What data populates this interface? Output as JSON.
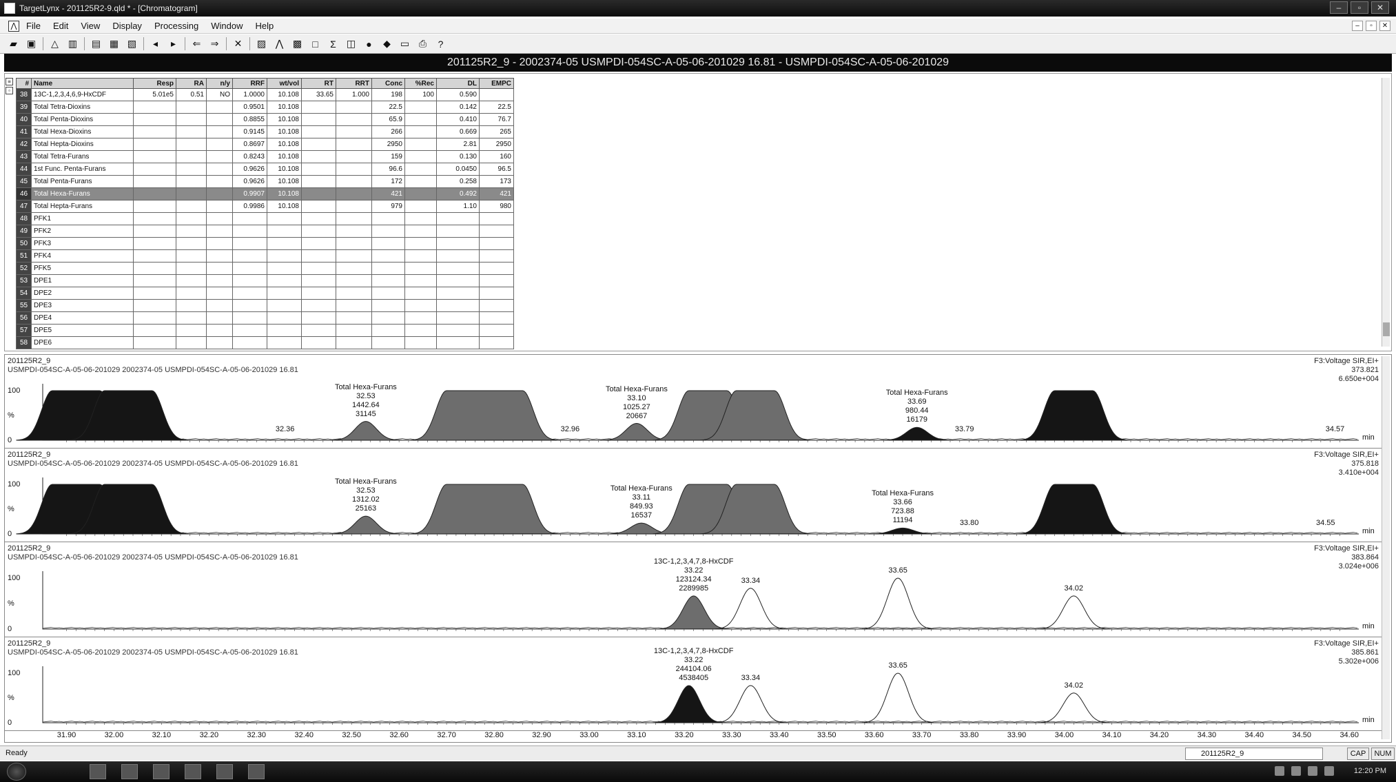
{
  "window": {
    "title": "TargetLynx - 201125R2-9.qld * - [Chromatogram]"
  },
  "menu": [
    "File",
    "Edit",
    "View",
    "Display",
    "Processing",
    "Window",
    "Help"
  ],
  "toolbar_icons": [
    "open-icon",
    "save-icon",
    "sep",
    "integrate-icon",
    "quantify-icon",
    "sep",
    "report-icon",
    "preview-icon",
    "print-preview-icon",
    "sep",
    "prev-sample-icon",
    "next-sample-icon",
    "sep",
    "prev-compound-icon",
    "next-compound-icon",
    "sep",
    "zoom-icon",
    "sep",
    "tools-icon",
    "peak-icon",
    "chromatogram-icon",
    "spectrum-icon",
    "table-icon",
    "summary-icon",
    "settings-icon",
    "layout-icon",
    "split-icon",
    "print-icon",
    "help-icon"
  ],
  "sample_title": "201125R2_9 - 2002374-05 USMPDI-054SC-A-05-06-201029 16.81 - USMPDI-054SC-A-05-06-201029",
  "table": {
    "columns": [
      "#",
      "Name",
      "Resp",
      "RA",
      "n/y",
      "RRF",
      "wt/vol",
      "RT",
      "RRT",
      "Conc",
      "%Rec",
      "DL",
      "EMPC"
    ],
    "rows": [
      [
        "38",
        "13C-1,2,3,4,6,9-HxCDF",
        "5.01e5",
        "0.51",
        "NO",
        "1.0000",
        "10.108",
        "33.65",
        "1.000",
        "198",
        "100",
        "0.590",
        ""
      ],
      [
        "39",
        "Total Tetra-Dioxins",
        "",
        "",
        "",
        "0.9501",
        "10.108",
        "",
        "",
        "22.5",
        "",
        "0.142",
        "22.5"
      ],
      [
        "40",
        "Total Penta-Dioxins",
        "",
        "",
        "",
        "0.8855",
        "10.108",
        "",
        "",
        "65.9",
        "",
        "0.410",
        "76.7"
      ],
      [
        "41",
        "Total Hexa-Dioxins",
        "",
        "",
        "",
        "0.9145",
        "10.108",
        "",
        "",
        "266",
        "",
        "0.669",
        "265"
      ],
      [
        "42",
        "Total Hepta-Dioxins",
        "",
        "",
        "",
        "0.8697",
        "10.108",
        "",
        "",
        "2950",
        "",
        "2.81",
        "2950"
      ],
      [
        "43",
        "Total Tetra-Furans",
        "",
        "",
        "",
        "0.8243",
        "10.108",
        "",
        "",
        "159",
        "",
        "0.130",
        "160"
      ],
      [
        "44",
        "1st Func. Penta-Furans",
        "",
        "",
        "",
        "0.9626",
        "10.108",
        "",
        "",
        "96.6",
        "",
        "0.0450",
        "96.5"
      ],
      [
        "45",
        "Total Penta-Furans",
        "",
        "",
        "",
        "0.9626",
        "10.108",
        "",
        "",
        "172",
        "",
        "0.258",
        "173"
      ],
      [
        "46",
        "Total Hexa-Furans",
        "",
        "",
        "",
        "0.9907",
        "10.108",
        "",
        "",
        "421",
        "",
        "0.492",
        "421"
      ],
      [
        "47",
        "Total Hepta-Furans",
        "",
        "",
        "",
        "0.9986",
        "10.108",
        "",
        "",
        "979",
        "",
        "1.10",
        "980"
      ],
      [
        "48",
        "PFK1",
        "",
        "",
        "",
        "",
        "",
        "",
        "",
        "",
        "",
        "",
        ""
      ],
      [
        "49",
        "PFK2",
        "",
        "",
        "",
        "",
        "",
        "",
        "",
        "",
        "",
        "",
        ""
      ],
      [
        "50",
        "PFK3",
        "",
        "",
        "",
        "",
        "",
        "",
        "",
        "",
        "",
        "",
        ""
      ],
      [
        "51",
        "PFK4",
        "",
        "",
        "",
        "",
        "",
        "",
        "",
        "",
        "",
        "",
        ""
      ],
      [
        "52",
        "PFK5",
        "",
        "",
        "",
        "",
        "",
        "",
        "",
        "",
        "",
        "",
        ""
      ],
      [
        "53",
        "DPE1",
        "",
        "",
        "",
        "",
        "",
        "",
        "",
        "",
        "",
        "",
        ""
      ],
      [
        "54",
        "DPE2",
        "",
        "",
        "",
        "",
        "",
        "",
        "",
        "",
        "",
        "",
        ""
      ],
      [
        "55",
        "DPE3",
        "",
        "",
        "",
        "",
        "",
        "",
        "",
        "",
        "",
        "",
        ""
      ],
      [
        "56",
        "DPE4",
        "",
        "",
        "",
        "",
        "",
        "",
        "",
        "",
        "",
        "",
        ""
      ],
      [
        "57",
        "DPE5",
        "",
        "",
        "",
        "",
        "",
        "",
        "",
        "",
        "",
        "",
        ""
      ],
      [
        "58",
        "DPE6",
        "",
        "",
        "",
        "",
        "",
        "",
        "",
        "",
        "",
        "",
        ""
      ]
    ],
    "selected_row": "46"
  },
  "chromatograms": [
    {
      "sample": "201125R2_9",
      "desc": "USMPDI-054SC-A-05-06-201029 2002374-05 USMPDI-054SC-A-05-06-201029 16.81",
      "channel": "F3:Voltage SIR,EI+",
      "mass": "373.821",
      "intensity": "6.650e+004",
      "peaks": [
        {
          "rt": 31.92,
          "h": 1.0,
          "fill": "dark",
          "flat": 0.05
        },
        {
          "rt": 32.03,
          "h": 1.0,
          "fill": "dark",
          "flat": 0.05
        },
        {
          "rt": 32.53,
          "h": 0.38,
          "fill": "mid",
          "flat": 0
        },
        {
          "rt": 32.78,
          "h": 1.0,
          "fill": "mid",
          "flat": 0.08
        },
        {
          "rt": 33.1,
          "h": 0.34,
          "fill": "mid",
          "flat": 0
        },
        {
          "rt": 33.25,
          "h": 1.0,
          "fill": "mid",
          "flat": 0.04
        },
        {
          "rt": 33.35,
          "h": 1.0,
          "fill": "mid",
          "flat": 0.04
        },
        {
          "rt": 33.69,
          "h": 0.26,
          "fill": "dark",
          "flat": 0
        },
        {
          "rt": 34.02,
          "h": 1.0,
          "fill": "dark",
          "flat": 0.04
        }
      ],
      "annotations": [
        {
          "rt": 32.53,
          "lines": [
            "Total Hexa-Furans",
            "32.53",
            "1442.64",
            "31145"
          ]
        },
        {
          "rt": 33.1,
          "lines": [
            "Total Hexa-Furans",
            "33.10",
            "1025.27",
            "20667"
          ]
        },
        {
          "rt": 33.69,
          "lines": [
            "Total Hexa-Furans",
            "33.69",
            "980.44",
            "16179"
          ]
        }
      ],
      "rt_labels": [
        "32.36",
        "32.96",
        "33.79",
        "34.57"
      ],
      "rt_label_pos": [
        32.36,
        32.96,
        33.79,
        34.57
      ]
    },
    {
      "sample": "201125R2_9",
      "desc": "USMPDI-054SC-A-05-06-201029 2002374-05 USMPDI-054SC-A-05-06-201029 16.81",
      "channel": "F3:Voltage SIR,EI+",
      "mass": "375.818",
      "intensity": "3.410e+004",
      "peaks": [
        {
          "rt": 31.92,
          "h": 1.0,
          "fill": "dark",
          "flat": 0.05
        },
        {
          "rt": 32.03,
          "h": 1.0,
          "fill": "dark",
          "flat": 0.05
        },
        {
          "rt": 32.53,
          "h": 0.36,
          "fill": "mid",
          "flat": 0
        },
        {
          "rt": 32.78,
          "h": 1.0,
          "fill": "mid",
          "flat": 0.08
        },
        {
          "rt": 33.11,
          "h": 0.22,
          "fill": "mid",
          "flat": 0
        },
        {
          "rt": 33.25,
          "h": 1.0,
          "fill": "mid",
          "flat": 0.04
        },
        {
          "rt": 33.35,
          "h": 1.0,
          "fill": "mid",
          "flat": 0.04
        },
        {
          "rt": 33.66,
          "h": 0.12,
          "fill": "dark",
          "flat": 0
        },
        {
          "rt": 34.02,
          "h": 1.0,
          "fill": "dark",
          "flat": 0.04
        }
      ],
      "annotations": [
        {
          "rt": 32.53,
          "lines": [
            "Total Hexa-Furans",
            "32.53",
            "1312.02",
            "25163"
          ]
        },
        {
          "rt": 33.11,
          "lines": [
            "Total Hexa-Furans",
            "33.11",
            "849.93",
            "16537"
          ]
        },
        {
          "rt": 33.66,
          "lines": [
            "Total Hexa-Furans",
            "33.66",
            "723.88",
            "11194"
          ]
        }
      ],
      "rt_labels": [
        "33.80",
        "34.55"
      ],
      "rt_label_pos": [
        33.8,
        34.55
      ]
    },
    {
      "sample": "201125R2_9",
      "desc": "USMPDI-054SC-A-05-06-201029 2002374-05 USMPDI-054SC-A-05-06-201029 16.81",
      "channel": "F3:Voltage SIR,EI+",
      "mass": "383.864",
      "intensity": "3.024e+006",
      "peaks": [
        {
          "rt": 33.22,
          "h": 0.65,
          "fill": "mid",
          "flat": 0
        },
        {
          "rt": 33.34,
          "h": 0.8,
          "fill": "none",
          "flat": 0
        },
        {
          "rt": 33.65,
          "h": 1.0,
          "fill": "none",
          "flat": 0
        },
        {
          "rt": 34.02,
          "h": 0.65,
          "fill": "none",
          "flat": 0
        }
      ],
      "annotations": [
        {
          "rt": 33.22,
          "lines": [
            "13C-1,2,3,4,7,8-HxCDF",
            "33.22",
            "123124.34",
            "2289985"
          ]
        },
        {
          "rt": 33.34,
          "lines": [
            "33.34"
          ]
        },
        {
          "rt": 33.65,
          "lines": [
            "33.65"
          ]
        },
        {
          "rt": 34.02,
          "lines": [
            "34.02"
          ]
        }
      ],
      "rt_labels": [],
      "rt_label_pos": []
    },
    {
      "sample": "201125R2_9",
      "desc": "USMPDI-054SC-A-05-06-201029 2002374-05 USMPDI-054SC-A-05-06-201029 16.81",
      "channel": "F3:Voltage SIR,EI+",
      "mass": "385.861",
      "intensity": "5.302e+006",
      "peaks": [
        {
          "rt": 33.21,
          "h": 0.75,
          "fill": "dark",
          "flat": 0
        },
        {
          "rt": 33.34,
          "h": 0.75,
          "fill": "none",
          "flat": 0
        },
        {
          "rt": 33.65,
          "h": 1.0,
          "fill": "none",
          "flat": 0
        },
        {
          "rt": 34.02,
          "h": 0.6,
          "fill": "none",
          "flat": 0
        }
      ],
      "annotations": [
        {
          "rt": 33.22,
          "lines": [
            "13C-1,2,3,4,7,8-HxCDF",
            "33.22",
            "244104.06",
            "4538405"
          ]
        },
        {
          "rt": 33.34,
          "lines": [
            "33.34"
          ]
        },
        {
          "rt": 33.65,
          "lines": [
            "33.65"
          ]
        },
        {
          "rt": 34.02,
          "lines": [
            "34.02"
          ]
        }
      ],
      "rt_labels": [],
      "rt_label_pos": []
    }
  ],
  "y_labels": {
    "top": "100",
    "mid": "%",
    "bottom": "0"
  },
  "x_unit": "min",
  "x_axis": {
    "min": 31.85,
    "max": 34.62,
    "ticks": [
      "31.90",
      "32.00",
      "32.10",
      "32.20",
      "32.30",
      "32.40",
      "32.50",
      "32.60",
      "32.70",
      "32.80",
      "32.90",
      "33.00",
      "33.10",
      "33.20",
      "33.30",
      "33.40",
      "33.50",
      "33.60",
      "33.70",
      "33.80",
      "33.90",
      "34.00",
      "34.10",
      "34.20",
      "34.30",
      "34.40",
      "34.50",
      "34.60"
    ]
  },
  "colors": {
    "dark": "#151515",
    "mid": "#6d6d6d",
    "line": "#222222"
  },
  "status": {
    "text": "Ready",
    "sample": "201125R2_9",
    "cap": "CAP",
    "num": "NUM"
  },
  "taskbar": {
    "clock": "12:20 PM"
  }
}
